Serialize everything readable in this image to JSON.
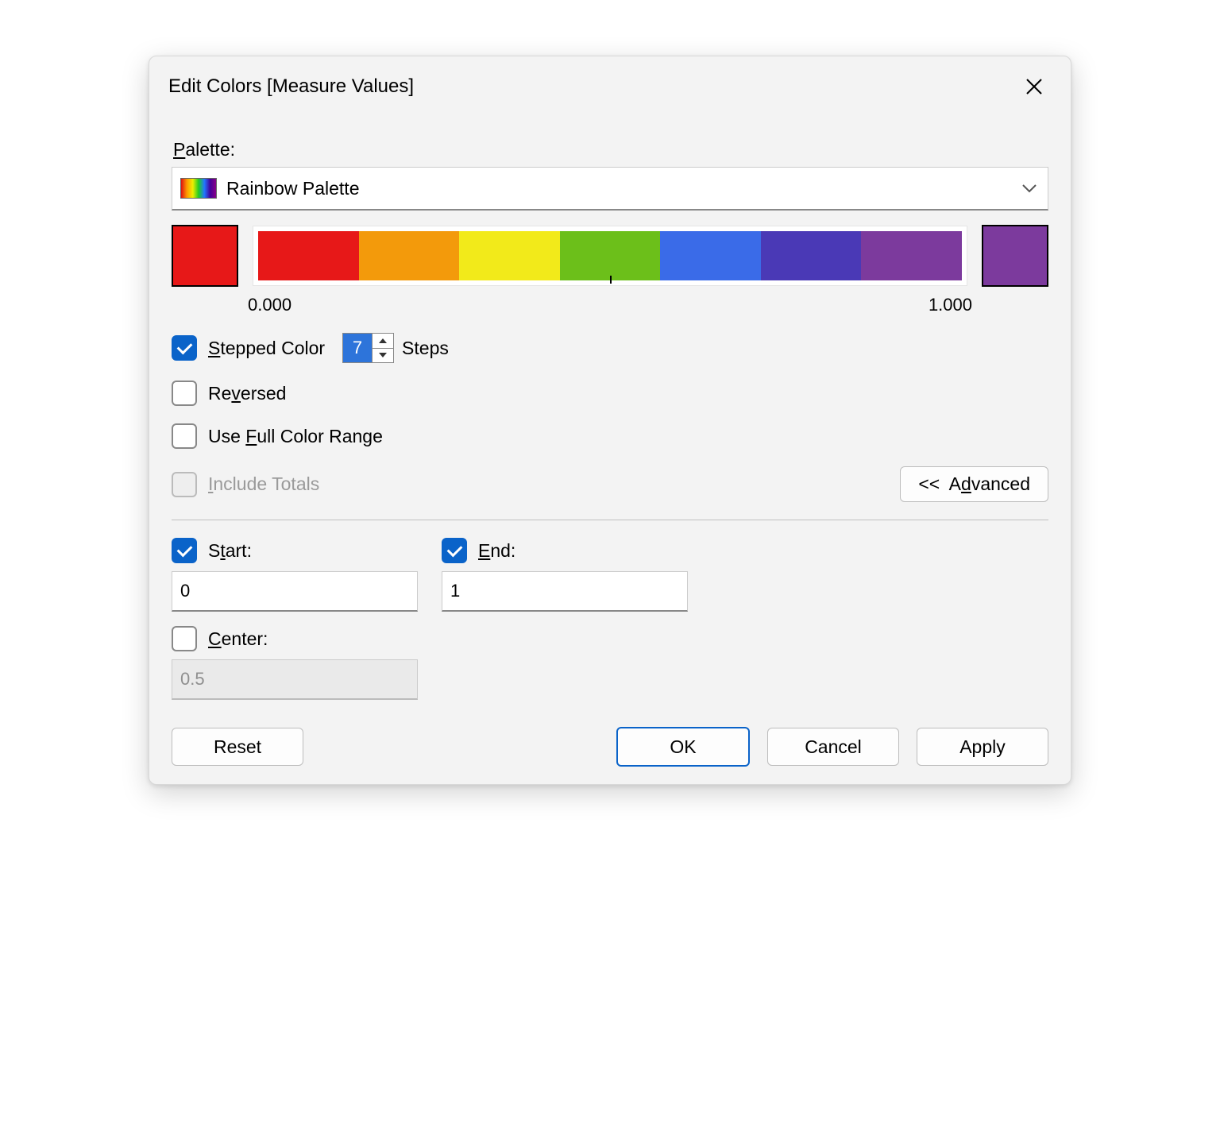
{
  "title": "Edit Colors [Measure Values]",
  "palette_label": "Palette:",
  "palette_name": "Rainbow Palette",
  "range": {
    "min_label": "0.000",
    "max_label": "1.000"
  },
  "start_color": "#e71818",
  "end_color": "#7c3a9d",
  "steps_colors": [
    "#e71818",
    "#f39a0b",
    "#f2ea1a",
    "#6cbf1a",
    "#3a6be8",
    "#4a39b6",
    "#7c3a9d"
  ],
  "stepped_label": "Stepped Color",
  "stepped_checked": true,
  "steps_value": "7",
  "steps_word": "Steps",
  "reversed_label": "Reversed",
  "reversed_checked": false,
  "full_range_label": "Use Full Color Range",
  "full_range_checked": false,
  "include_totals_label": "Include Totals",
  "include_totals_enabled": false,
  "advanced_label": "<<  Advanced",
  "start": {
    "label": "Start:",
    "checked": true,
    "value": "0"
  },
  "end": {
    "label": "End:",
    "checked": true,
    "value": "1"
  },
  "center": {
    "label": "Center:",
    "checked": false,
    "value": "0.5",
    "enabled": false
  },
  "buttons": {
    "reset": "Reset",
    "ok": "OK",
    "cancel": "Cancel",
    "apply": "Apply"
  }
}
